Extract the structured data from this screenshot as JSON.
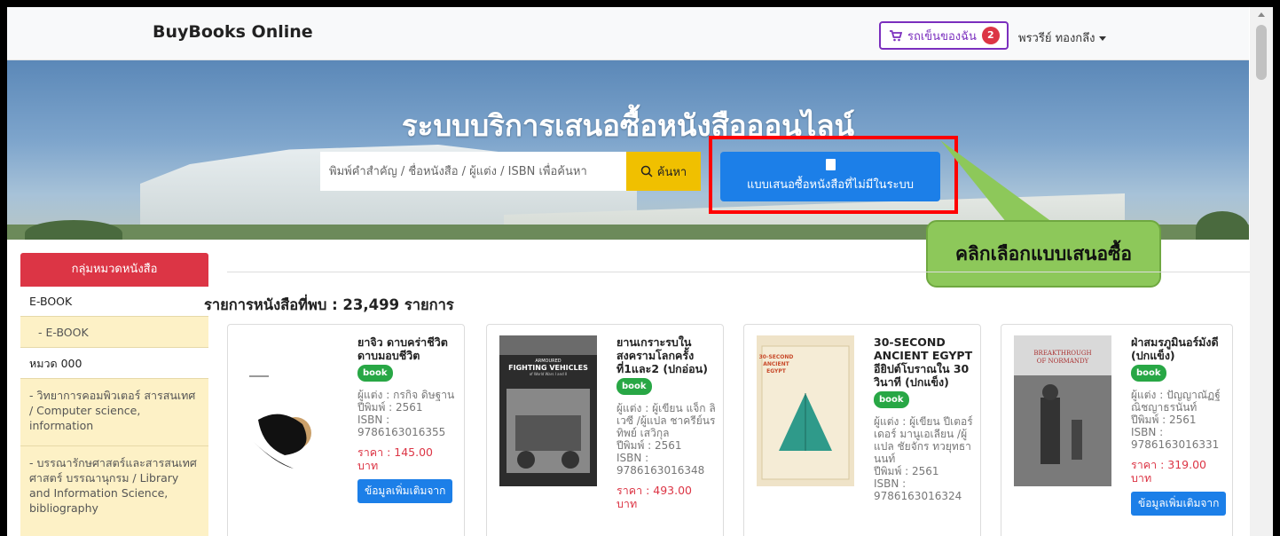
{
  "navbar": {
    "brand": "BuyBooks Online",
    "cart_label": "รถเข็นของฉัน",
    "cart_count": "2",
    "user_name": "พรวรีย์ ทองกลึง"
  },
  "hero": {
    "title": "ระบบบริการเสนอซื้อหนังสือออนไลน์",
    "search_placeholder": "พิมพ์คำสำคัญ / ชื่อหนังสือ / ผู้แต่ง / ISBN เพื่อค้นหา",
    "search_button": "ค้นหา",
    "propose_button": "แบบเสนอซื้อหนังสือที่ไม่มีในระบบ"
  },
  "callout": {
    "text": "คลิกเลือกแบบเสนอซื้อ",
    "color": "#8dc85a"
  },
  "sidebar": {
    "header": "กลุ่มหมวดหนังสือ",
    "items": [
      {
        "label": "E-BOOK",
        "type": "head"
      },
      {
        "label": "- E-BOOK",
        "type": "sub"
      },
      {
        "label": "หมวด 000",
        "type": "head"
      },
      {
        "label": "- วิทยาการคอมพิวเตอร์ สารสนเทศ / Computer science, information",
        "type": "sub"
      },
      {
        "label": "- บรรณารักษศาสตร์และสารสนเทศศาสตร์ บรรณานุกรม / Library and Information Science, bibliography",
        "type": "sub"
      }
    ]
  },
  "main": {
    "results_label": "รายการหนังสือที่พบ : 23,499 รายการ",
    "books": [
      {
        "title": "ยาจิว ดาบคร่าชีวิต ดาบมอบชีวิต",
        "tag": "book",
        "author": "ผู้แต่ง : กรกิจ ดิษฐาน",
        "year": "ปีพิมพ์ : 2561",
        "isbn_label": "ISBN :",
        "isbn": "9786163016355",
        "price": "ราคา : 145.00 บาท",
        "more": "ข้อมูลเพิ่มเติมจาก"
      },
      {
        "title": "ยานเกราะรบในสงครามโลกครั้งที่1และ2 (ปกอ่อน)",
        "tag": "book",
        "author": "ผู้แต่ง : ผู้เขียน แจ็ก ลิเวซี /ผู้แปล ชาครีย์นรทิพย์ เสวิกุล",
        "year": "ปีพิมพ์ : 2561",
        "isbn_label": "ISBN :",
        "isbn": "9786163016348",
        "price": "ราคา : 493.00 บาท",
        "cover_text_1": "ARMOURED",
        "cover_text_2": "FIGHTING VEHICLES",
        "cover_text_3": "of World Wars I and II"
      },
      {
        "title": "30-SECOND ANCIENT EGYPT อียิปต์โบราณใน 30 วินาที (ปกแข็ง)",
        "tag": "book",
        "author": "ผู้แต่ง : ผู้เขียน ปีเตอร์ เดอร์ มานูเอเลียน /ผู้แปล ชัยจักร ทวยุทธานนท์",
        "year": "ปีพิมพ์ : 2561",
        "isbn_label": "ISBN :",
        "isbn": "9786163016324",
        "cover_text_1": "30-SECOND",
        "cover_text_2": "ANCIENT",
        "cover_text_3": "EGYPT"
      },
      {
        "title": "ฝ่าสมรภูมินอร์มังดี (ปกแข็ง)",
        "tag": "book",
        "author": "ผู้แต่ง : ปัญญาณัฏฐ์ ณิชญาธรนันท์",
        "year": "ปีพิมพ์ : 2561",
        "isbn_label": "ISBN :",
        "isbn": "9786163016331",
        "price": "ราคา : 319.00 บาท",
        "more": "ข้อมูลเพิ่มเติมจาก",
        "cover_text_1": "BREAKTHROUGH",
        "cover_text_2": "OF NORMANDY"
      }
    ]
  }
}
